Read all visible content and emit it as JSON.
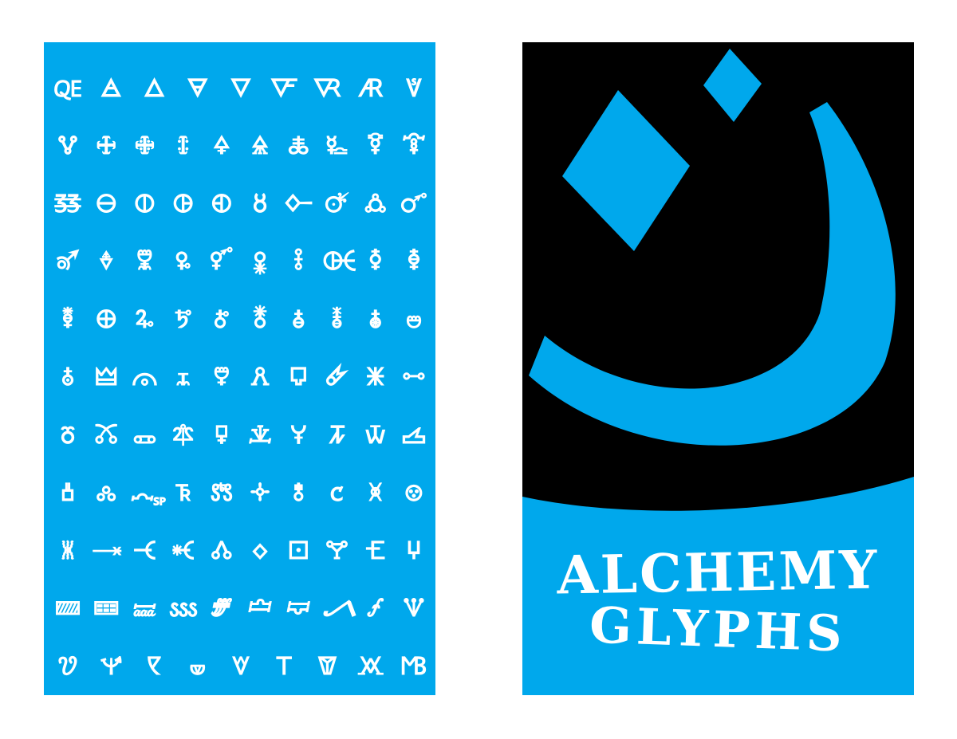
{
  "colors": {
    "accent": "#00a8ec",
    "dark": "#000000",
    "glyph": "#ffffff",
    "paper": "#ffffff"
  },
  "specimen": {
    "rows": [
      [
        "🜀",
        "🜁",
        "🜂",
        "🜃",
        "🜄",
        "🜅",
        "🜆",
        "🜇",
        "🜈"
      ],
      [
        "🜉",
        "🜊",
        "🜋",
        "🜌",
        "🜍",
        "🜎",
        "🜏",
        "🜐",
        "🜑",
        "🜒"
      ],
      [
        "🜓",
        "🜔",
        "🜕",
        "🜖",
        "🜗",
        "🜘",
        "🜙",
        "🜚",
        "🜛",
        "🜜"
      ],
      [
        "🜝",
        "🜞",
        "🜟",
        "🜠",
        "🜡",
        "🜢",
        "🜣",
        "🜤",
        "🜥",
        "🜦"
      ],
      [
        "🜧",
        "🜨",
        "🜩",
        "🜪",
        "🜫",
        "🜬",
        "🜭",
        "🜮",
        "🜯",
        "🜰"
      ],
      [
        "🜱",
        "🜲",
        "🜳",
        "🜴",
        "🜵",
        "🜶",
        "🜷",
        "🜸",
        "🜹",
        "🜺"
      ],
      [
        "🜻",
        "🜼",
        "🜽",
        "🜾",
        "🜿",
        "🝀",
        "🝁",
        "🝂",
        "🝃",
        "🝄"
      ],
      [
        "🝅",
        "🝆",
        "🝇",
        "🝈",
        "🝉",
        "🝊",
        "🝋",
        "🝌",
        "🝍",
        "🝎"
      ],
      [
        "🝏",
        "🝐",
        "🝑",
        "🝒",
        "🝓",
        "🝔",
        "🝕",
        "🝖",
        "🝗",
        "🝘"
      ],
      [
        "🝙",
        "🝚",
        "🝛",
        "🝜",
        "🝝",
        "🝞",
        "🝟",
        "🝠",
        "🝡",
        "🝢"
      ],
      [
        "🝣",
        "🝤",
        "🝥",
        "🝦",
        "🝧",
        "🝨",
        "🝩",
        "🝪",
        "🝫"
      ]
    ]
  },
  "cover": {
    "title_line_1": "ALCHEMY",
    "title_line_2": "GLYPHS",
    "emblem_icon": "crescent-with-diamonds-icon"
  }
}
